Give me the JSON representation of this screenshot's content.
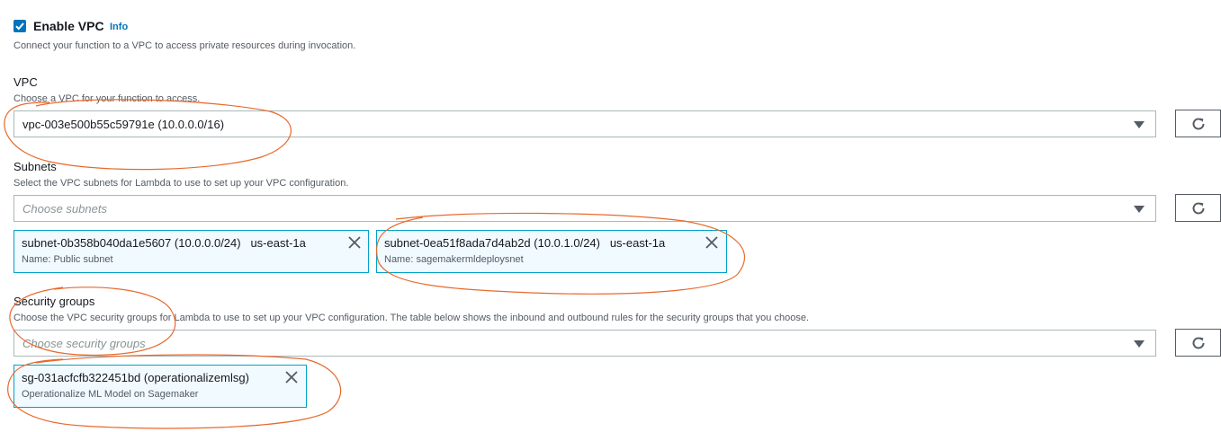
{
  "enable": {
    "label": "Enable VPC",
    "info": "Info",
    "checked": true,
    "description": "Connect your function to a VPC to access private resources during invocation."
  },
  "vpc": {
    "label": "VPC",
    "description": "Choose a VPC for your function to access.",
    "selected": "vpc-003e500b55c59791e (10.0.0.0/16)"
  },
  "subnets": {
    "label": "Subnets",
    "description": "Select the VPC subnets for Lambda to use to set up your VPC configuration.",
    "placeholder": "Choose subnets",
    "tokens": [
      {
        "id": "subnet-0b358b040da1e5607 (10.0.0.0/24)",
        "az": "us-east-1a",
        "name": "Name: Public subnet"
      },
      {
        "id": "subnet-0ea51f8ada7d4ab2d (10.0.1.0/24)",
        "az": "us-east-1a",
        "name": "Name: sagemakermldeploysnet"
      }
    ]
  },
  "security_groups": {
    "label": "Security groups",
    "description": "Choose the VPC security groups for Lambda to use to set up your VPC configuration. The table below shows the inbound and outbound rules for the security groups that you choose.",
    "placeholder": "Choose security groups",
    "tokens": [
      {
        "id": "sg-031acfcfb322451bd (operationalizemlsg)",
        "name": "Operationalize ML Model on Sagemaker"
      }
    ]
  },
  "colors": {
    "accent": "#0073bb",
    "token_border": "#00a1c9",
    "annotation": "#e8692c"
  }
}
